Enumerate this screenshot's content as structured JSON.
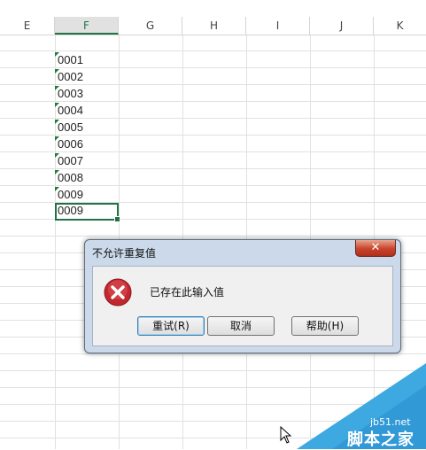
{
  "columns": [
    "E",
    "F",
    "G",
    "H",
    "I",
    "J",
    "K"
  ],
  "selected_column": "F",
  "cells": [
    "0001",
    "0002",
    "0003",
    "0004",
    "0005",
    "0006",
    "0007",
    "0008",
    "0009"
  ],
  "active_cell_value": "0009",
  "dialog": {
    "title": "不允许重复值",
    "close_label": "✕",
    "message": "已存在此输入值",
    "buttons": {
      "retry": "重试(R)",
      "cancel": "取消",
      "help": "帮助(H)"
    },
    "icon": "error-icon"
  },
  "watermark": {
    "url": "jb51.net",
    "name": "脚本之家"
  },
  "colors": {
    "excel_green": "#217346",
    "error_red": "#c1272d",
    "watermark_blue": "#3ea9e0"
  }
}
